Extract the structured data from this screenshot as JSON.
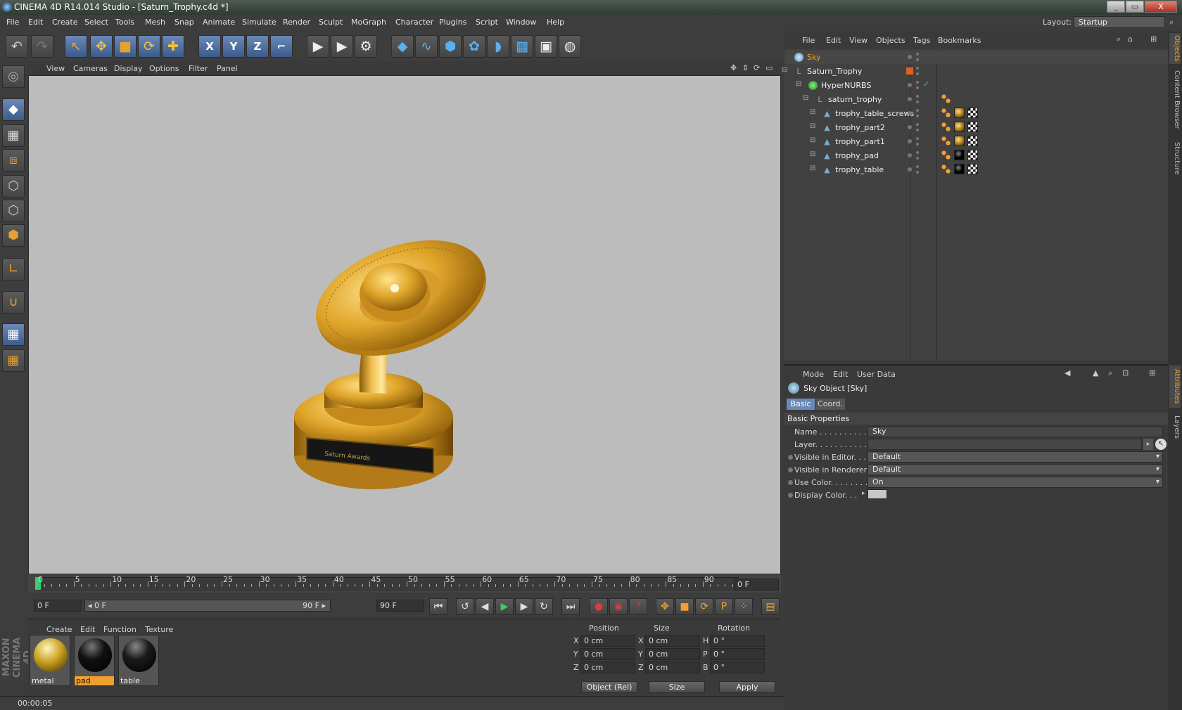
{
  "window": {
    "title": "CINEMA 4D R14.014 Studio - [Saturn_Trophy.c4d *]",
    "min": "_",
    "max": "▭",
    "close": "X"
  },
  "menu": [
    "File",
    "Edit",
    "Create",
    "Select",
    "Tools",
    "Mesh",
    "Snap",
    "Animate",
    "Simulate",
    "Render",
    "Sculpt",
    "MoGraph",
    "Character",
    "Plugins",
    "Script",
    "Window",
    "Help"
  ],
  "layout": {
    "label": "Layout:",
    "value": "Startup"
  },
  "toolbar": {
    "undo": "↶",
    "redo": "↷",
    "tools": [
      {
        "name": "live-selection-icon",
        "glyph": "↖"
      },
      {
        "name": "move-icon",
        "glyph": "✥"
      },
      {
        "name": "scale-icon",
        "glyph": "■"
      },
      {
        "name": "rotate-icon",
        "glyph": "⟳"
      },
      {
        "name": "recent-tool-icon",
        "glyph": "✚"
      },
      {
        "name": "x-axis-icon",
        "glyph": "X"
      },
      {
        "name": "y-axis-icon",
        "glyph": "Y"
      },
      {
        "name": "z-axis-icon",
        "glyph": "Z"
      },
      {
        "name": "coordinate-system-icon",
        "glyph": "⌐"
      },
      {
        "name": "render-view-icon",
        "glyph": "▶"
      },
      {
        "name": "render-picture-viewer-icon",
        "glyph": "▶"
      },
      {
        "name": "render-settings-icon",
        "glyph": "⚙"
      },
      {
        "name": "cube-icon",
        "glyph": "◆"
      },
      {
        "name": "spline-icon",
        "glyph": "∿"
      },
      {
        "name": "nurbs-icon",
        "glyph": "⬢"
      },
      {
        "name": "mograph-cloner-icon",
        "glyph": "✿"
      },
      {
        "name": "deformer-icon",
        "glyph": "◗"
      },
      {
        "name": "floor-icon",
        "glyph": "▦"
      },
      {
        "name": "camera-icon",
        "glyph": "▣"
      },
      {
        "name": "light-icon",
        "glyph": "◍"
      }
    ]
  },
  "viewport": {
    "menu": [
      "View",
      "Cameras",
      "Display",
      "Options",
      "Filter",
      "Panel"
    ],
    "plate_text": "Saturn Awards"
  },
  "timeline": {
    "ticks": [
      "0",
      "5",
      "10",
      "15",
      "20",
      "25",
      "30",
      "35",
      "40",
      "45",
      "50",
      "55",
      "60",
      "65",
      "70",
      "75",
      "80",
      "85",
      "90"
    ],
    "current_frame": "0 F"
  },
  "transport": {
    "start_field": "0 F",
    "range_start": "◂ 0 F",
    "range_end": "90 F ▸",
    "end_field": "90 F",
    "buttons": [
      {
        "name": "go-to-start-icon",
        "glyph": "⏮"
      },
      {
        "name": "step-back-key-icon",
        "glyph": "↺"
      },
      {
        "name": "step-back-icon",
        "glyph": "◀"
      },
      {
        "name": "play-icon",
        "glyph": "▶"
      },
      {
        "name": "step-forward-icon",
        "glyph": "▶"
      },
      {
        "name": "loop-icon",
        "glyph": "↻"
      },
      {
        "name": "go-to-end-icon",
        "glyph": "⏭"
      }
    ]
  },
  "materials": {
    "menu": [
      "Create",
      "Edit",
      "Function",
      "Texture"
    ],
    "items": [
      {
        "name": "metal",
        "color": "#c9a020"
      },
      {
        "name": "pad",
        "color": "#111111"
      },
      {
        "name": "table",
        "color": "#1a1a1a"
      }
    ]
  },
  "coords": {
    "headers": [
      "Position",
      "Size",
      "Rotation"
    ],
    "rows": [
      {
        "axis": "X",
        "pos": "0 cm",
        "size_axis": "X",
        "size": "0 cm",
        "rot_axis": "H",
        "rot": "0 °"
      },
      {
        "axis": "Y",
        "pos": "0 cm",
        "size_axis": "Y",
        "size": "0 cm",
        "rot_axis": "P",
        "rot": "0 °"
      },
      {
        "axis": "Z",
        "pos": "0 cm",
        "size_axis": "Z",
        "size": "0 cm",
        "rot_axis": "B",
        "rot": "0 °"
      }
    ],
    "mode": "Object (Rel)",
    "size_mode": "Size",
    "apply": "Apply"
  },
  "status": {
    "text": "00:00:05"
  },
  "objects": {
    "menu": [
      "File",
      "Edit",
      "View",
      "Objects",
      "Tags",
      "Bookmarks"
    ],
    "rows": [
      {
        "name": "Sky",
        "indent": 0,
        "selected": true,
        "icon": "sky",
        "tags": []
      },
      {
        "name": "Saturn_Trophy",
        "indent": 0,
        "selected": false,
        "icon": "null",
        "tags": []
      },
      {
        "name": "HyperNURBS",
        "indent": 1,
        "selected": false,
        "icon": "nurbs",
        "tags": []
      },
      {
        "name": "saturn_trophy",
        "indent": 2,
        "selected": false,
        "icon": "null",
        "tags": [
          "phong"
        ]
      },
      {
        "name": "trophy_table_screws",
        "indent": 3,
        "selected": false,
        "icon": "poly",
        "tags": [
          "phong",
          "gold",
          "checker"
        ]
      },
      {
        "name": "trophy_part2",
        "indent": 3,
        "selected": false,
        "icon": "poly",
        "tags": [
          "phong",
          "gold",
          "checker"
        ]
      },
      {
        "name": "trophy_part1",
        "indent": 3,
        "selected": false,
        "icon": "poly",
        "tags": [
          "phong",
          "gold",
          "checker"
        ]
      },
      {
        "name": "trophy_pad",
        "indent": 3,
        "selected": false,
        "icon": "poly",
        "tags": [
          "phong",
          "black",
          "checker"
        ]
      },
      {
        "name": "trophy_table",
        "indent": 3,
        "selected": false,
        "icon": "poly",
        "tags": [
          "phong",
          "black",
          "checker"
        ]
      }
    ]
  },
  "attributes": {
    "menu": [
      "Mode",
      "Edit",
      "User Data"
    ],
    "object_title": "Sky Object [Sky]",
    "tabs": [
      "Basic",
      "Coord."
    ],
    "section": "Basic Properties",
    "fields": [
      {
        "label": "Name . . . . . . . . . . .",
        "value": "Sky",
        "type": "text",
        "radio": false
      },
      {
        "label": "Layer. . . . . . . . . . .",
        "value": "",
        "type": "layer",
        "radio": false
      },
      {
        "label": "Visible in Editor. . .",
        "value": "Default",
        "type": "drop",
        "radio": true
      },
      {
        "label": "Visible in Renderer",
        "value": "Default",
        "type": "drop",
        "radio": true
      },
      {
        "label": "Use Color. . . . . . . .",
        "value": "On",
        "type": "drop",
        "radio": true
      },
      {
        "label": "Display Color. . .",
        "value": "",
        "type": "color",
        "radio": true
      }
    ]
  },
  "side_tabs": [
    "Objects",
    "Content Browser",
    "Structure",
    "Attributes",
    "Layers"
  ]
}
